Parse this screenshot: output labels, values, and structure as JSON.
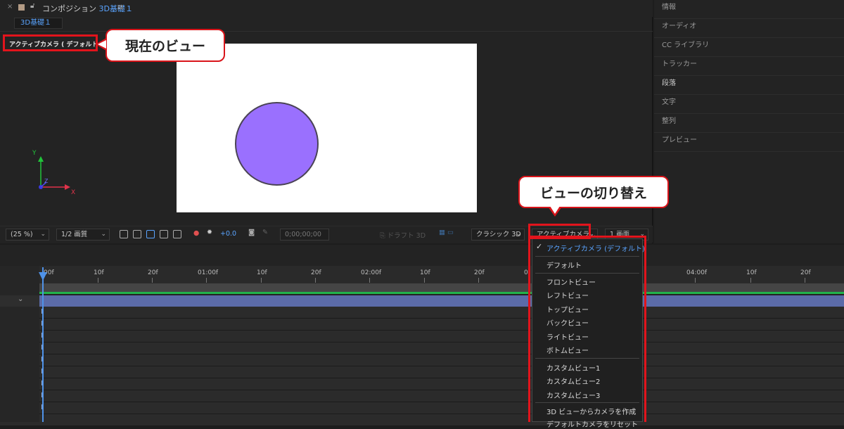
{
  "composition_tab": {
    "close_icon": "×",
    "title_prefix": "コンポジション",
    "comp_name": "3D基礎１",
    "subtab": "3D基礎１"
  },
  "viewer": {
    "view_label": "アクティブカメラ ( デフォルト )",
    "axis_x": "X",
    "axis_y": "Y",
    "axis_z": "Z"
  },
  "callouts": {
    "current_view": "現在のビュー",
    "switch_view": "ビューの切り替え"
  },
  "comp_toolbar": {
    "zoom": "(25 %)",
    "resolution": "1/2 画質",
    "exposure": "+0.0",
    "timecode": "0;00;00;00",
    "draft3d": "ドラフト 3D",
    "renderer": "クラシック 3D",
    "view_select": "アクティブカメラ...",
    "layout_select": "1 画面"
  },
  "right_panel": {
    "items": [
      "情報",
      "オーディオ",
      "CC ライブラリ",
      "トラッカー",
      "段落",
      "文字",
      "整列",
      "プレビュー"
    ]
  },
  "timeline": {
    "ruler_labels": [
      "00f",
      "10f",
      "20f",
      "01:00f",
      "10f",
      "20f",
      "02:00f",
      "10f",
      "20f",
      "0",
      "04:00f",
      "10f",
      "20f"
    ]
  },
  "view_menu": {
    "selected": "アクティブカメラ (デフォルト)",
    "items": {
      "default": "デフォルト",
      "front": "フロントビュー",
      "left": "レフトビュー",
      "top": "トップビュー",
      "back": "バックビュー",
      "right": "ライトビュー",
      "bottom": "ボトムビュー",
      "custom1": "カスタムビュー1",
      "custom2": "カスタムビュー2",
      "custom3": "カスタムビュー3",
      "create_camera": "3D ビューからカメラを作成",
      "last_partial": "デフォルトカメラをリセット"
    }
  },
  "colors": {
    "accent_blue": "#5aa4ff",
    "highlight_red": "#e2141c",
    "circle_fill": "#9a70fe",
    "layer_bar": "#5b6ba8",
    "green_line": "#21b34b"
  }
}
